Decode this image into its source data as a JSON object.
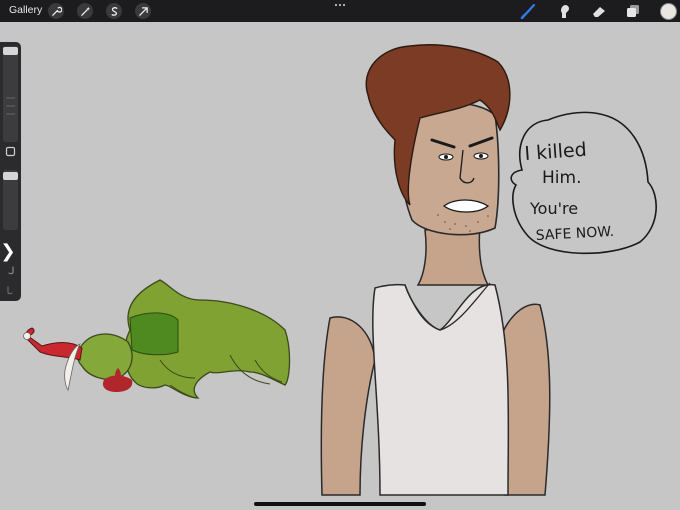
{
  "topbar": {
    "gallery_label": "Gallery",
    "left_tools": [
      "wrench-icon",
      "magic-wand-icon",
      "selection-icon",
      "transform-arrow-icon"
    ],
    "right_tools": [
      "brush-icon",
      "smudge-icon",
      "eraser-icon",
      "layers-icon"
    ],
    "active_tool": "brush-icon",
    "accent_color": "#2f7bf5",
    "current_color": "#ece6e2"
  },
  "sidebar": {
    "toggle_glyph": "❯"
  },
  "speech_bubble": {
    "lines": [
      "I killed",
      "Him.",
      "You're",
      "SAFE NOW."
    ]
  }
}
